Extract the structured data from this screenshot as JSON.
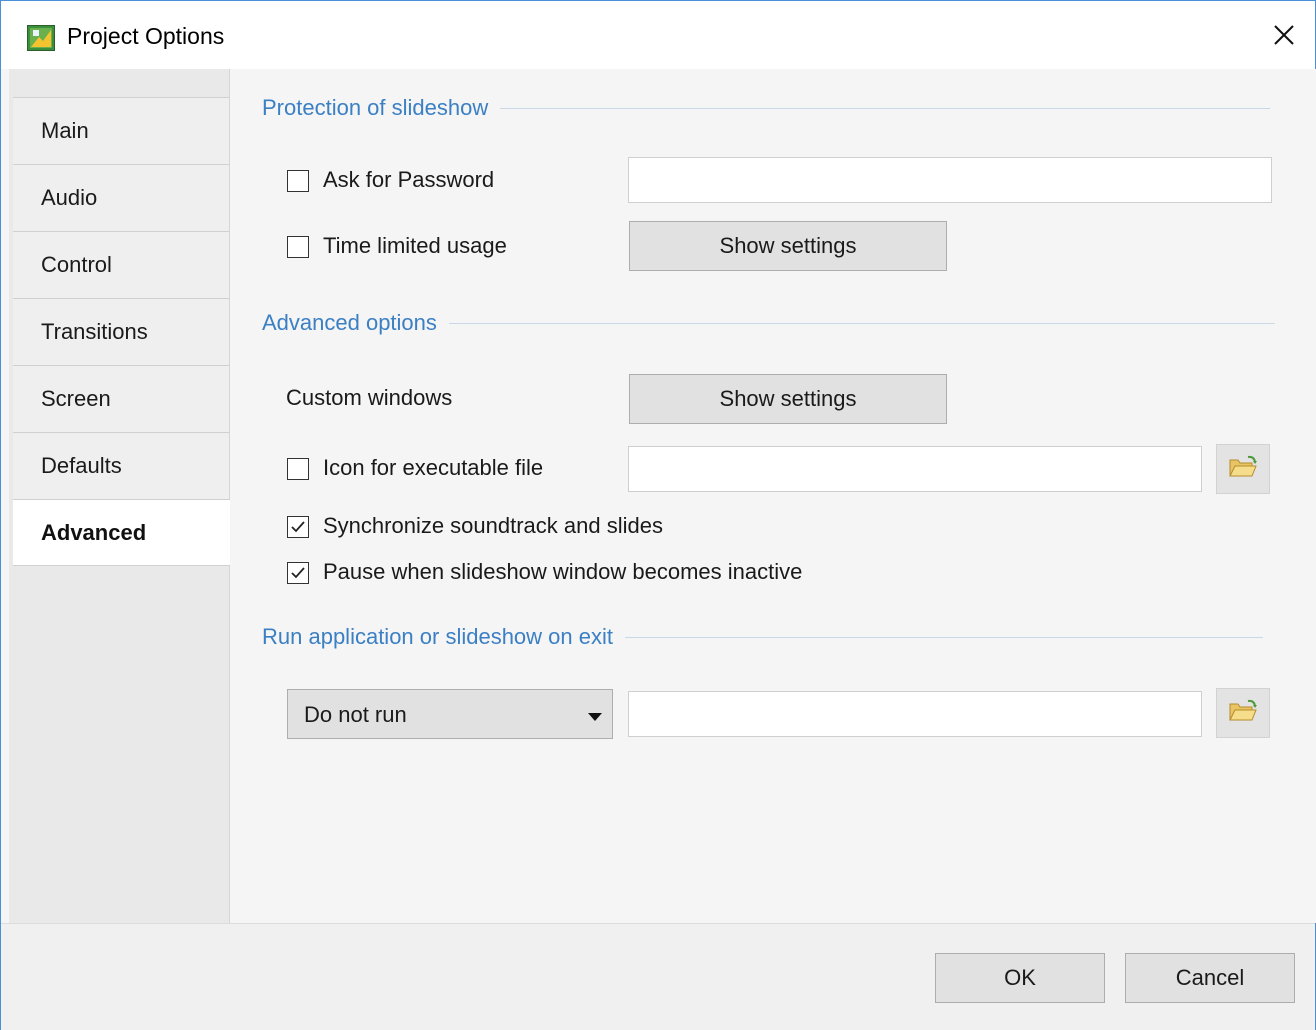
{
  "window": {
    "title": "Project Options",
    "app_icon": "project-options-icon",
    "close_glyph": "✕"
  },
  "sidebar": {
    "tabs": [
      {
        "label": "Main",
        "active": false
      },
      {
        "label": "Audio",
        "active": false
      },
      {
        "label": "Control",
        "active": false
      },
      {
        "label": "Transitions",
        "active": false
      },
      {
        "label": "Screen",
        "active": false
      },
      {
        "label": "Defaults",
        "active": false
      },
      {
        "label": "Advanced",
        "active": true
      }
    ]
  },
  "protection": {
    "header": "Protection of slideshow",
    "ask_password_label": "Ask for Password",
    "ask_password_checked": false,
    "password_value": "",
    "time_limited_label": "Time limited usage",
    "time_limited_checked": false,
    "show_settings_label": "Show settings"
  },
  "advanced": {
    "header": "Advanced options",
    "custom_windows_label": "Custom windows",
    "show_settings_label": "Show settings",
    "icon_exe_label": "Icon for executable file",
    "icon_exe_checked": false,
    "icon_exe_value": "",
    "sync_label": "Synchronize soundtrack and slides",
    "sync_checked": true,
    "pause_label": "Pause when slideshow window becomes inactive",
    "pause_checked": true
  },
  "run_on_exit": {
    "header": "Run application or slideshow on exit",
    "select_value": "Do not run",
    "path_value": ""
  },
  "footer": {
    "ok_label": "OK",
    "cancel_label": "Cancel"
  },
  "colors": {
    "accent": "#3b7fc4",
    "window_border": "#4a90d9"
  }
}
